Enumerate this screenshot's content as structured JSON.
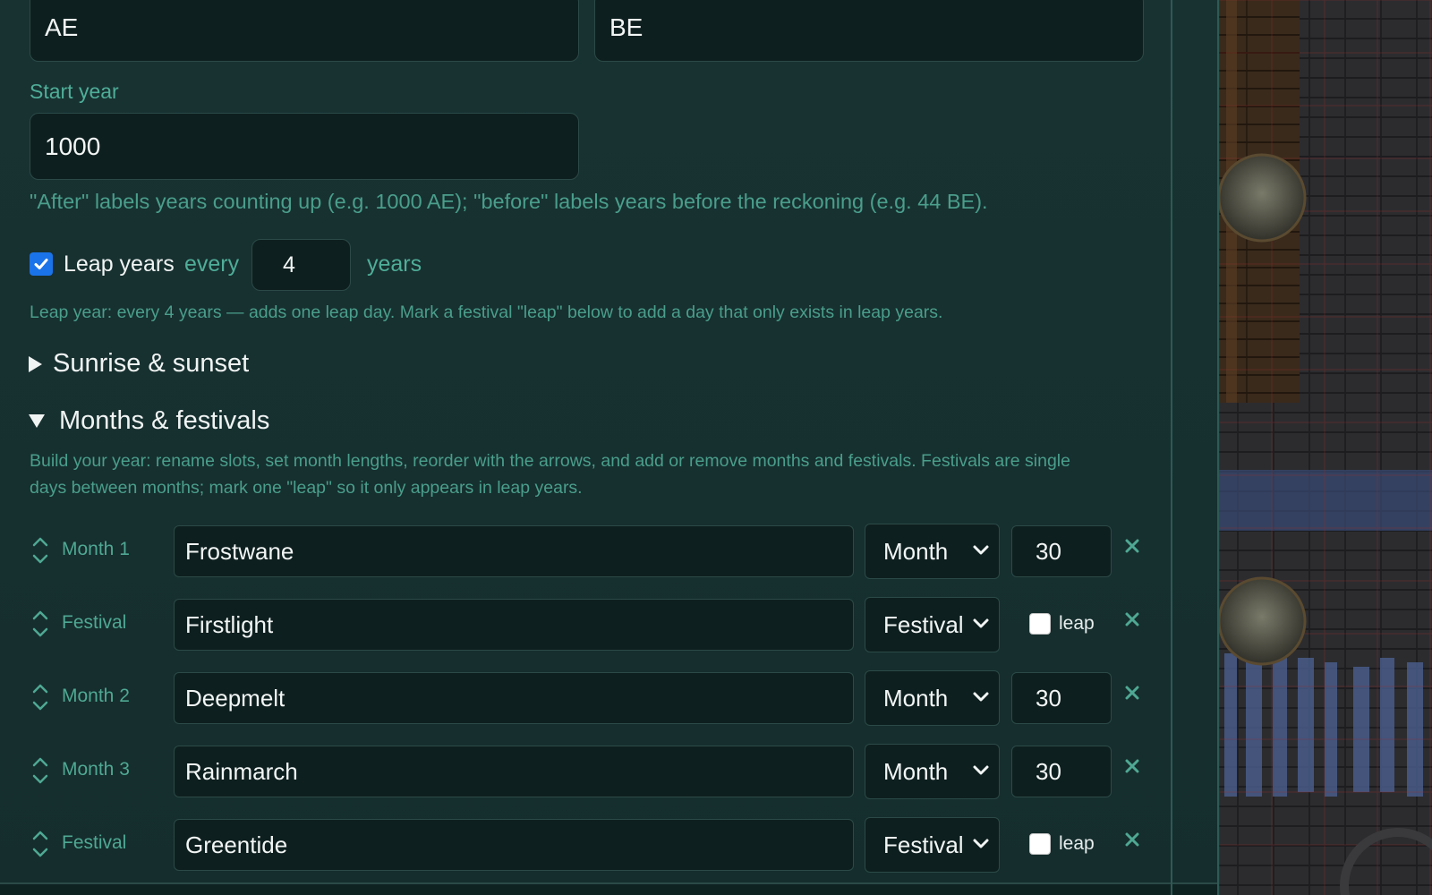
{
  "era": {
    "after_label": "AE",
    "before_label": "BE",
    "start_year_label": "Start year",
    "start_year": "1000",
    "hint": "\"After\" labels years counting up (e.g. 1000 AE); \"before\" labels years before the reckoning (e.g. 44 BE)."
  },
  "leap": {
    "checked": true,
    "label": "Leap years",
    "every_label": "every",
    "every_value": "4",
    "years_label": "years",
    "hint": "Leap year: every 4 years — adds one leap day. Mark a festival \"leap\" below to add a day that only exists in leap years."
  },
  "sections": {
    "sunrise": {
      "title": "Sunrise & sunset",
      "expanded": false
    },
    "months": {
      "title": "Months & festivals",
      "expanded": true,
      "hint_line1": "Build your year: rename slots, set month lengths, reorder with the arrows, and add or remove months and festivals. Festivals are single",
      "hint_line2": "days between months; mark one \"leap\" so it only appears in leap years."
    }
  },
  "rows": [
    {
      "label": "Month 1",
      "name": "Frostwane",
      "type": "Month",
      "days": "30"
    },
    {
      "label": "Festival",
      "name": "Firstlight",
      "type": "Festival",
      "leap_label": "leap",
      "leap": false
    },
    {
      "label": "Month 2",
      "name": "Deepmelt",
      "type": "Month",
      "days": "30"
    },
    {
      "label": "Month 3",
      "name": "Rainmarch",
      "type": "Month",
      "days": "30"
    },
    {
      "label": "Festival",
      "name": "Greentide",
      "type": "Festival",
      "leap_label": "leap",
      "leap": false
    }
  ],
  "icons": {
    "reorder": "up-down-chevron-icon",
    "remove": "close-icon",
    "select": "chevron-down-icon",
    "checkbox": "checkmark-icon"
  },
  "colors": {
    "panel_bg": "#183232",
    "accent_text": "#4fae98",
    "checkbox_blue": "#1a73e8",
    "input_bg": "#0e1f1f"
  }
}
